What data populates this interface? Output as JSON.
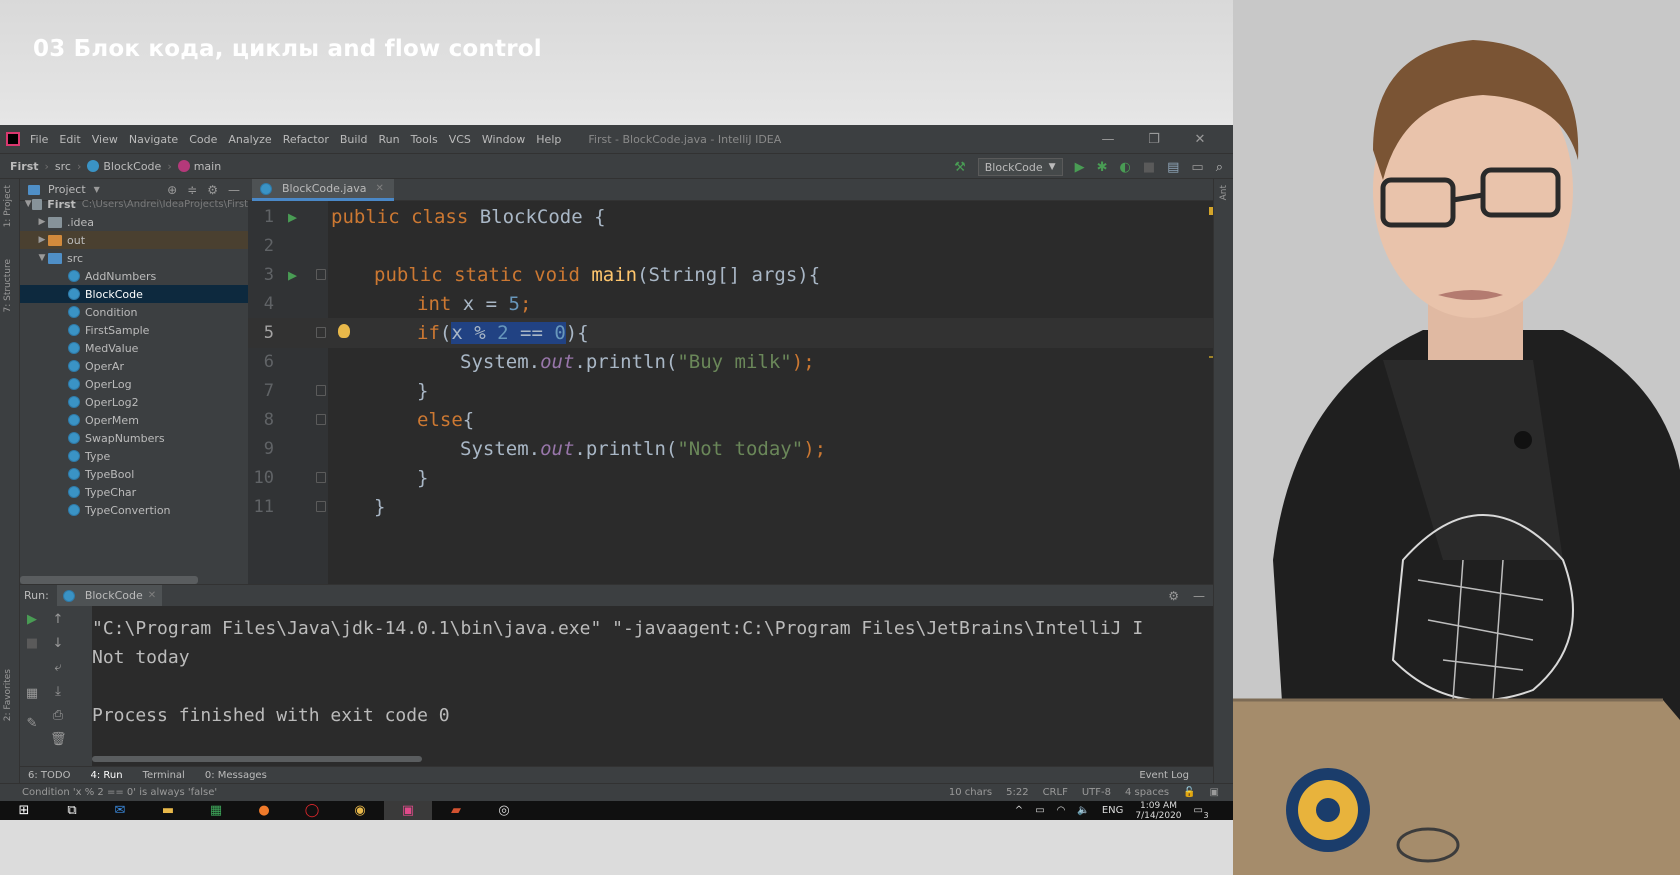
{
  "slide": {
    "title": "03 Блок кода, циклы and flow control"
  },
  "window": {
    "title": "First - BlockCode.java - IntelliJ IDEA",
    "controls": [
      "—",
      "❐",
      "✕"
    ]
  },
  "menu": [
    "File",
    "Edit",
    "View",
    "Navigate",
    "Code",
    "Analyze",
    "Refactor",
    "Build",
    "Run",
    "Tools",
    "VCS",
    "Window",
    "Help"
  ],
  "breadcrumbs": [
    "First",
    "src",
    "BlockCode",
    "main"
  ],
  "toolbar": {
    "run_config": "BlockCode"
  },
  "side_tabs": {
    "project": "1: Project",
    "structure": "7: Structure",
    "favorites": "2: Favorites",
    "ant": "Ant"
  },
  "project_panel": {
    "title": "Project",
    "root": "First",
    "root_path": "C:\\Users\\Andrei\\IdeaProjects\\First",
    "folders": [
      ".idea",
      "out",
      "src"
    ],
    "classes": [
      "AddNumbers",
      "BlockCode",
      "Condition",
      "FirstSample",
      "MedValue",
      "OperAr",
      "OperLog",
      "OperLog2",
      "OperMem",
      "SwapNumbers",
      "Type",
      "TypeBool",
      "TypeChar",
      "TypeConvertion"
    ],
    "selected": "BlockCode"
  },
  "editor": {
    "tab": "BlockCode.java",
    "line_numbers": [
      "1",
      "2",
      "3",
      "4",
      "5",
      "6",
      "7",
      "8",
      "9",
      "10",
      "11"
    ],
    "code": {
      "l1_kw": "public class ",
      "l1_rest": "BlockCode {",
      "l3_kw": "public static void ",
      "l3_method": "main",
      "l3_rest": "(String[] args){",
      "l4_kw": "int ",
      "l4_rest": "x = ",
      "l4_num": "5",
      "l4_end": ";",
      "l5_kw": "if",
      "l5_open": "(",
      "l5_sel1": "x % ",
      "l5_sel_num1": "2",
      "l5_sel2": " == ",
      "l5_sel_num2": "0",
      "l5_rest": "){",
      "l6_pre": "System.",
      "l6_field": "out",
      "l6_call": ".println(",
      "l6_str": "\"Buy milk\"",
      "l6_end": ");",
      "l7": "}",
      "l8_kw": "else",
      "l8_rest": "{",
      "l9_pre": "System.",
      "l9_field": "out",
      "l9_call": ".println(",
      "l9_str": "\"Not today\"",
      "l9_end": ");",
      "l10": "}",
      "l11": "}"
    }
  },
  "run_panel": {
    "label": "Run:",
    "tab": "BlockCode",
    "console": [
      "\"C:\\Program Files\\Java\\jdk-14.0.1\\bin\\java.exe\" \"-javaagent:C:\\Program Files\\JetBrains\\IntelliJ I",
      "Not today",
      "",
      "Process finished with exit code 0"
    ]
  },
  "bottom_tools": [
    "6: TODO",
    "4: Run",
    "Terminal",
    "0: Messages"
  ],
  "event_log": "Event Log",
  "status": {
    "message": "Condition 'x % 2 == 0' is always 'false'",
    "chars": "10 chars",
    "position": "5:22",
    "line_sep": "CRLF",
    "encoding": "UTF-8",
    "indent": "4 spaces"
  },
  "taskbar": {
    "lang": "ENG",
    "time": "1:09 AM",
    "date": "7/14/2020",
    "notifications": "3"
  }
}
